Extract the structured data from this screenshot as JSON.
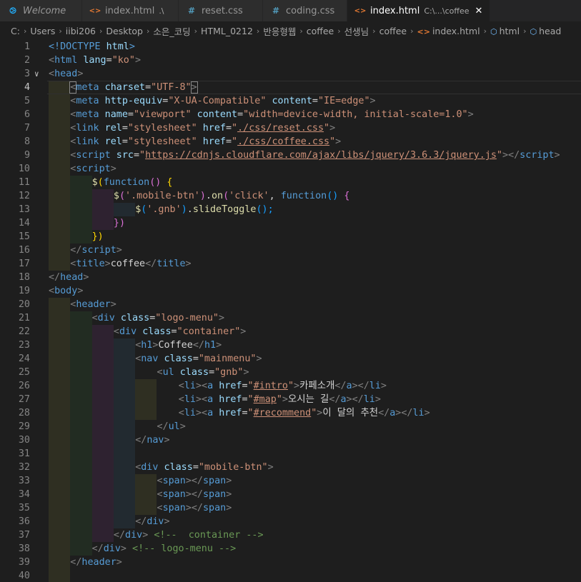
{
  "tabs": [
    {
      "label": "Welcome",
      "icon": "vscode-logo-icon",
      "italic": true
    },
    {
      "label": "index.html",
      "desc": ".\\",
      "icon": "html-file-icon"
    },
    {
      "label": "reset.css",
      "icon": "css-file-icon"
    },
    {
      "label": "coding.css",
      "icon": "css-file-icon"
    },
    {
      "label": "index.html",
      "desc": "C:\\...\\coffee",
      "icon": "html-file-icon",
      "active": true,
      "close": "✕"
    }
  ],
  "breadcrumb": [
    "C:",
    "Users",
    "iibi206",
    "Desktop",
    "소은_코딩",
    "HTML_0212",
    "반응형웹",
    "coffee",
    "선생님",
    "coffee",
    "index.html",
    "html",
    "head"
  ],
  "code": {
    "l1": [
      "<!DOCTYPE ",
      "html",
      ">"
    ],
    "l2": [
      "<",
      "html",
      " lang",
      "=",
      "\"ko\"",
      ">"
    ],
    "l3": [
      "<",
      "head",
      ">"
    ],
    "l4": [
      "<",
      "meta",
      " charset",
      "=",
      "\"UTF-8\"",
      ">"
    ],
    "l5": [
      "<",
      "meta",
      " http-equiv",
      "=",
      "\"X-UA-Compatible\"",
      " content",
      "=",
      "\"IE=edge\"",
      ">"
    ],
    "l6": [
      "<",
      "meta",
      " name",
      "=",
      "\"viewport\"",
      " content",
      "=",
      "\"width=device-width, initial-scale=1.0\"",
      ">"
    ],
    "l7": [
      "<",
      "link",
      " rel",
      "=",
      "\"stylesheet\"",
      " href",
      "=",
      "\"",
      "./css/reset.css",
      "\"",
      ">"
    ],
    "l8": [
      "<",
      "link",
      " rel",
      "=",
      "\"stylesheet\"",
      " href",
      "=",
      "\"",
      "./css/coffee.css",
      "\"",
      ">"
    ],
    "l9": [
      "<",
      "script",
      " src",
      "=",
      "\"",
      "https://cdnjs.cloudflare.com/ajax/libs/jquery/3.6.3/jquery.js",
      "\"",
      "></",
      "script",
      ">"
    ],
    "l10": [
      "<",
      "script",
      ">"
    ],
    "l11": [
      "$",
      "(",
      "function",
      "()",
      " {"
    ],
    "l12": [
      "$",
      "(",
      "'.mobile-btn'",
      ")",
      ".",
      "on",
      "(",
      "'click'",
      ", ",
      "function",
      "()",
      " {"
    ],
    "l13": [
      "$",
      "(",
      "'.gnb'",
      ")",
      ".",
      "slideToggle",
      "();"
    ],
    "l14": [
      "})"
    ],
    "l15": [
      "})"
    ],
    "l16": [
      "</",
      "script",
      ">"
    ],
    "l17": [
      "<",
      "title",
      ">",
      "coffee",
      "</",
      "title",
      ">"
    ],
    "l18": [
      "</",
      "head",
      ">"
    ],
    "l19": [
      "<",
      "body",
      ">"
    ],
    "l20": [
      "<",
      "header",
      ">"
    ],
    "l21": [
      "<",
      "div",
      " class",
      "=",
      "\"logo-menu\"",
      ">"
    ],
    "l22": [
      "<",
      "div",
      " class",
      "=",
      "\"container\"",
      ">"
    ],
    "l23": [
      "<",
      "h1",
      ">",
      "Coffee",
      "</",
      "h1",
      ">"
    ],
    "l24": [
      "<",
      "nav",
      " class",
      "=",
      "\"mainmenu\"",
      ">"
    ],
    "l25": [
      "<",
      "ul",
      " class",
      "=",
      "\"gnb\"",
      ">"
    ],
    "l26": [
      "<",
      "li",
      "><",
      "a",
      " href",
      "=",
      "\"",
      "#intro",
      "\"",
      ">",
      "카페소개",
      "</",
      "a",
      "></",
      "li",
      ">"
    ],
    "l27": [
      "<",
      "li",
      "><",
      "a",
      " href",
      "=",
      "\"",
      "#map",
      "\"",
      ">",
      "오시는 길",
      "</",
      "a",
      "></",
      "li",
      ">"
    ],
    "l28": [
      "<",
      "li",
      "><",
      "a",
      " href",
      "=",
      "\"",
      "#recommend",
      "\"",
      ">",
      "이 달의 추천",
      "</",
      "a",
      "></",
      "li",
      ">"
    ],
    "l29": [
      "</",
      "ul",
      ">"
    ],
    "l30": [
      "</",
      "nav",
      ">"
    ],
    "l31": [],
    "l32": [
      "<",
      "div",
      " class",
      "=",
      "\"mobile-btn\"",
      ">"
    ],
    "l33": [
      "<",
      "span",
      "></",
      "span",
      ">"
    ],
    "l34": [
      "<",
      "span",
      "></",
      "span",
      ">"
    ],
    "l35": [
      "<",
      "span",
      "></",
      "span",
      ">"
    ],
    "l36": [
      "</",
      "div",
      ">"
    ],
    "l37": [
      "</",
      "div",
      "> ",
      "<!--  container -->"
    ],
    "l38": [
      "</",
      "div",
      "> ",
      "<!-- logo-menu -->"
    ],
    "l39": [
      "</",
      "header",
      ">"
    ],
    "l40": []
  },
  "fold_markers": {
    "l3": "∨",
    "l10": "",
    "l19": ""
  },
  "line_numbers": [
    "1",
    "2",
    "3",
    "4",
    "5",
    "6",
    "7",
    "8",
    "9",
    "10",
    "11",
    "12",
    "13",
    "14",
    "15",
    "16",
    "17",
    "18",
    "19",
    "20",
    "21",
    "22",
    "23",
    "24",
    "25",
    "26",
    "27",
    "28",
    "29",
    "30",
    "31",
    "32",
    "33",
    "34",
    "35",
    "36",
    "37",
    "38",
    "39",
    "40"
  ]
}
